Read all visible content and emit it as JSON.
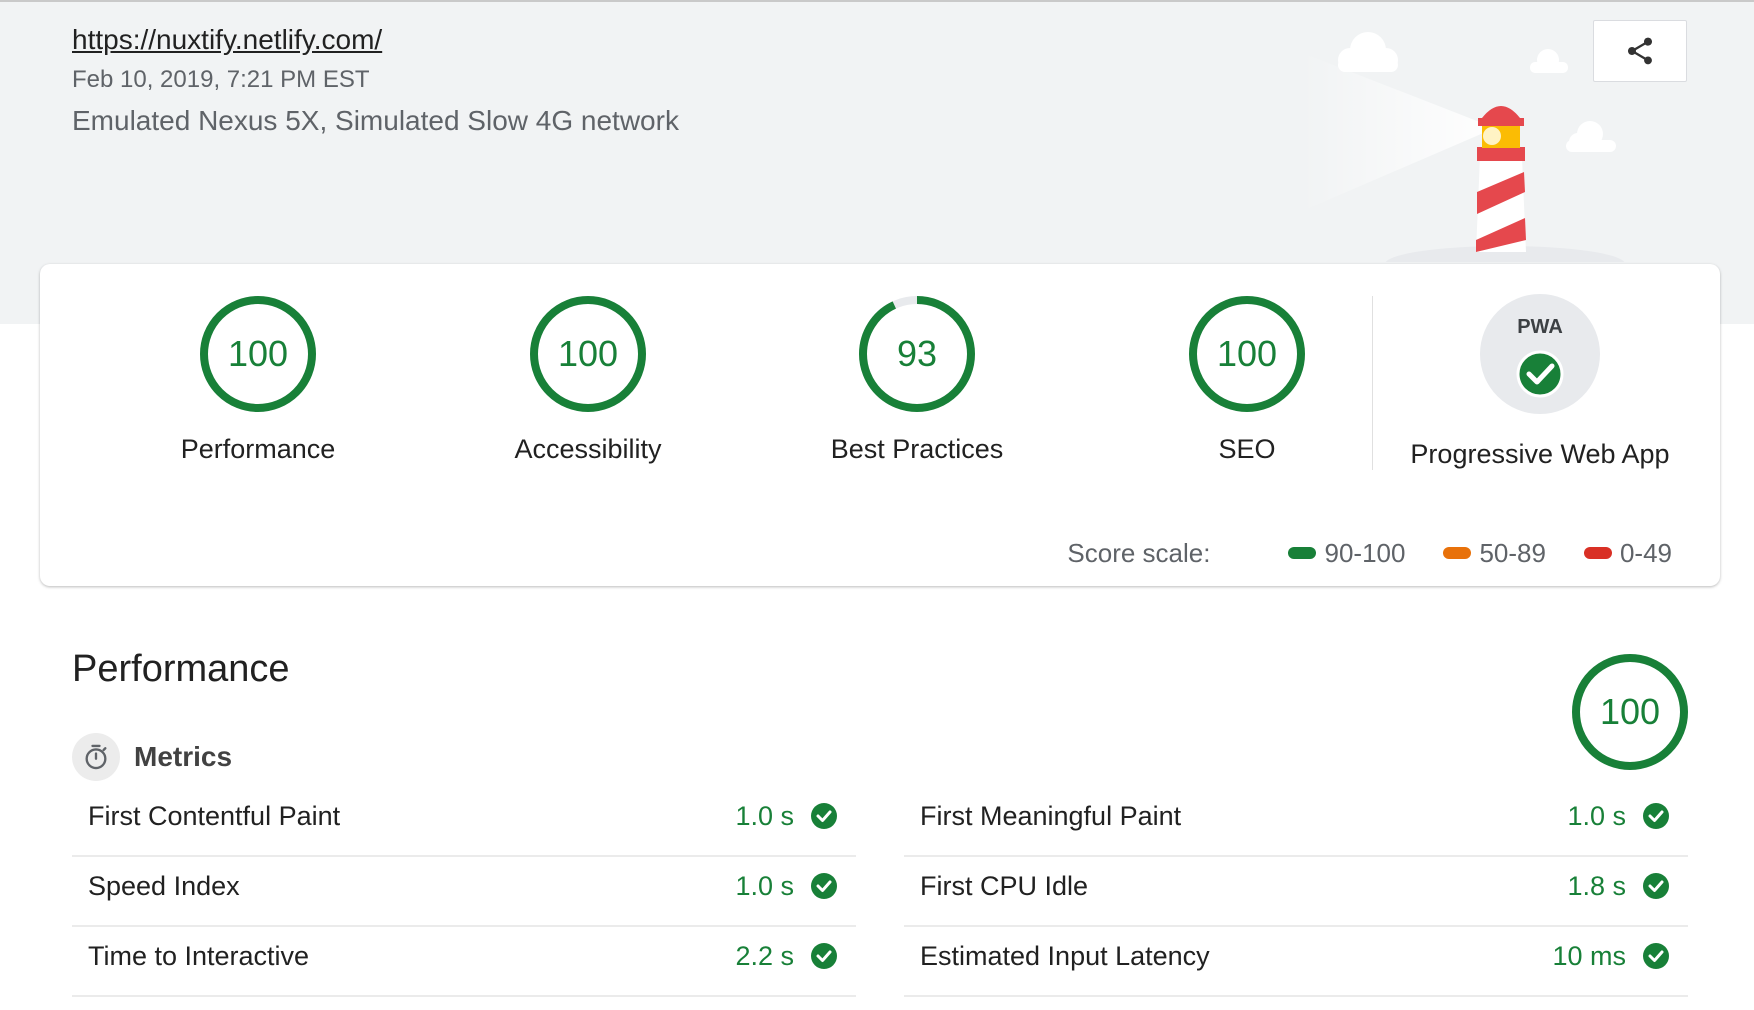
{
  "report": {
    "url": "https://nuxtify.netlify.com/",
    "timestamp": "Feb 10, 2019, 7:21 PM EST",
    "device": "Emulated Nexus 5X, Simulated Slow 4G network"
  },
  "colors": {
    "pass": "#188038",
    "average": "#e8710a",
    "fail": "#d93025"
  },
  "icons": {
    "share": "share-icon",
    "lighthouse": "lighthouse-illustration",
    "pwa_badge": "pwa-logo-icon",
    "pwa_check": "checkmark-icon",
    "metrics": "stopwatch-icon",
    "metric_status": "checkmark-icon"
  },
  "summary": {
    "categories": [
      {
        "label": "Performance",
        "score": "100",
        "fraction": 1.0
      },
      {
        "label": "Accessibility",
        "score": "100",
        "fraction": 1.0
      },
      {
        "label": "Best Practices",
        "score": "93",
        "fraction": 0.93
      },
      {
        "label": "SEO",
        "score": "100",
        "fraction": 1.0
      }
    ],
    "pwa": {
      "badge_text": "PWA",
      "label": "Progressive Web App"
    },
    "score_scale": {
      "title": "Score scale:",
      "pass": "90-100",
      "average": "50-89",
      "fail": "0-49"
    }
  },
  "performance": {
    "title": "Performance",
    "score": "100",
    "fraction": 1.0,
    "metrics_title": "Metrics",
    "metrics_left": [
      {
        "name": "First Contentful Paint",
        "value": "1.0 s"
      },
      {
        "name": "Speed Index",
        "value": "1.0 s"
      },
      {
        "name": "Time to Interactive",
        "value": "2.2 s"
      }
    ],
    "metrics_right": [
      {
        "name": "First Meaningful Paint",
        "value": "1.0 s"
      },
      {
        "name": "First CPU Idle",
        "value": "1.8 s"
      },
      {
        "name": "Estimated Input Latency",
        "value": "10 ms"
      }
    ]
  }
}
